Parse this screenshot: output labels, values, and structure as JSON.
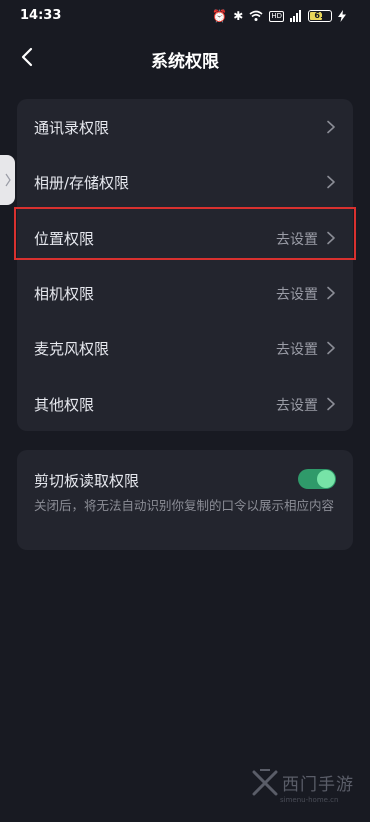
{
  "status_bar": {
    "time": "14:33",
    "icons": [
      "alarm-icon",
      "bluetooth-icon",
      "wifi-icon",
      "hd-icon",
      "signal-icon",
      "battery-icon",
      "charging-icon"
    ],
    "hd_label": "HD",
    "battery_level": "61",
    "battery_fraction": 0.61
  },
  "header": {
    "title": "系统权限",
    "back_icon": "chevron-left-icon"
  },
  "side_handle": {
    "icon": "chevron-right-icon"
  },
  "permissions": {
    "items": [
      {
        "label": "通讯录权限",
        "action": ""
      },
      {
        "label": "相册/存储权限",
        "action": ""
      },
      {
        "label": "位置权限",
        "action": "去设置",
        "highlighted": true
      },
      {
        "label": "相机权限",
        "action": "去设置"
      },
      {
        "label": "麦克风权限",
        "action": "去设置"
      },
      {
        "label": "其他权限",
        "action": "去设置"
      }
    ]
  },
  "clipboard": {
    "title": "剪切板读取权限",
    "description": "关闭后，将无法自动识别你复制的口令以展示相应内容",
    "enabled": true
  },
  "watermark": {
    "text": "西门手游",
    "url": "simenu-home.cn"
  },
  "colors": {
    "background": "#181a22",
    "card": "#23252e",
    "toggle_on": "#2f9a6a",
    "highlight": "#d9312f"
  }
}
